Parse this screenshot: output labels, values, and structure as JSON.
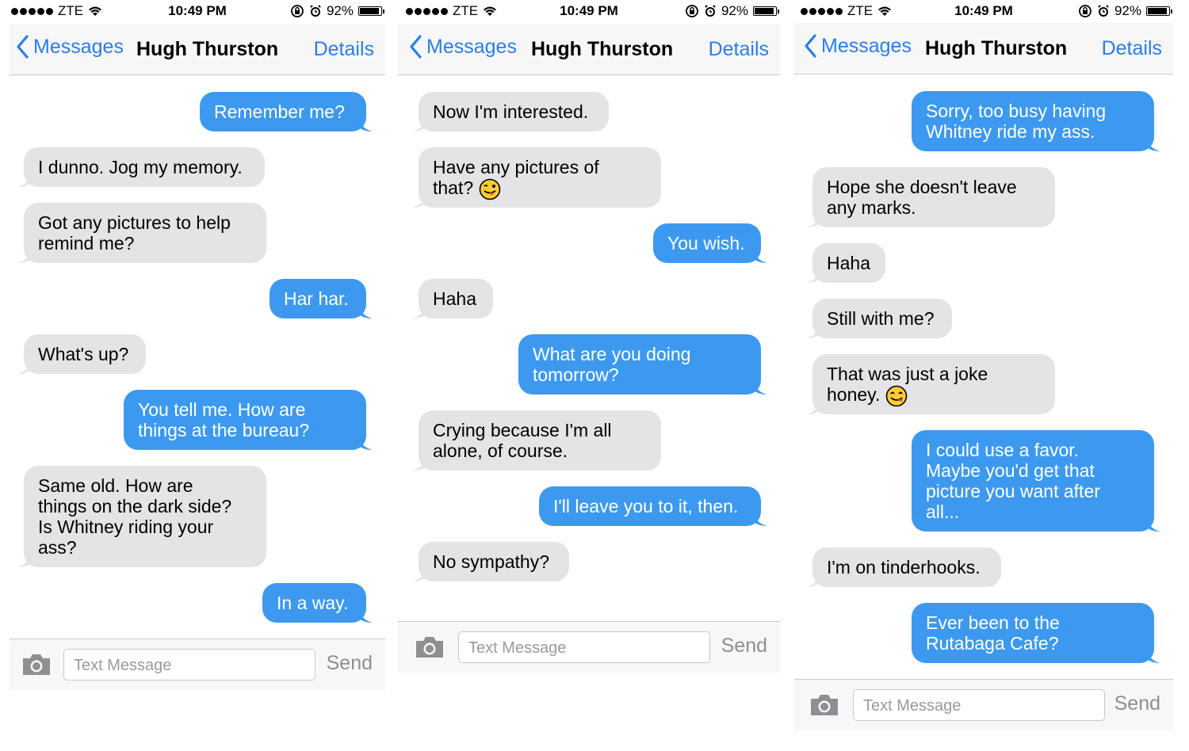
{
  "status": {
    "carrier": "ZTE",
    "time": "10:49 PM",
    "battery": "92%",
    "battery_level": 0.92,
    "icons": [
      "signal-dots-icon",
      "wifi-icon",
      "orientation-lock-icon",
      "alarm-icon",
      "battery-icon"
    ]
  },
  "nav": {
    "back_label": "Messages",
    "contact": "Hugh Thurston",
    "details_label": "Details"
  },
  "input": {
    "placeholder": "Text Message",
    "send_label": "Send"
  },
  "colors": {
    "accent": "#2b7de9",
    "outgoing_bubble": "#3c99ef",
    "incoming_bubble": "#e4e4e6"
  },
  "screens": [
    {
      "messages": [
        {
          "from": "me",
          "text": "Remember me?"
        },
        {
          "from": "them",
          "text": "I dunno. Jog my memory."
        },
        {
          "from": "them",
          "text": "Got any pictures to help\nremind me?"
        },
        {
          "from": "me",
          "text": "Har har."
        },
        {
          "from": "them",
          "text": "What's up?"
        },
        {
          "from": "me",
          "text": "You tell me. How are\nthings at the bureau?"
        },
        {
          "from": "them",
          "text": "Same old. How are\nthings on the dark side?\nIs Whitney riding your\nass?"
        },
        {
          "from": "me",
          "text": "In a way."
        }
      ]
    },
    {
      "messages": [
        {
          "from": "them",
          "text": "Now I'm interested."
        },
        {
          "from": "them",
          "text": "Have any pictures of\nthat?",
          "emoji": "winking-tongue-emoji"
        },
        {
          "from": "me",
          "text": "You wish."
        },
        {
          "from": "them",
          "text": "Haha"
        },
        {
          "from": "me",
          "text": "What are you doing\ntomorrow?"
        },
        {
          "from": "them",
          "text": "Crying because I'm all\nalone, of course."
        },
        {
          "from": "me",
          "text": "I'll leave you to it, then."
        },
        {
          "from": "them",
          "text": "No sympathy?"
        }
      ]
    },
    {
      "messages": [
        {
          "from": "me",
          "text": "Sorry, too busy having\nWhitney ride my ass."
        },
        {
          "from": "them",
          "text": "Hope she doesn't leave\nany marks."
        },
        {
          "from": "them",
          "text": "Haha"
        },
        {
          "from": "them",
          "text": "Still with me?"
        },
        {
          "from": "them",
          "text": "That was just a joke\nhoney.",
          "emoji": "yum-tongue-emoji"
        },
        {
          "from": "me",
          "text": "I could use a favor.\nMaybe you'd get that\npicture you want after\nall..."
        },
        {
          "from": "them",
          "text": "I'm on tinderhooks."
        },
        {
          "from": "me",
          "text": "Ever been to the\nRutabaga Cafe?"
        }
      ]
    }
  ]
}
